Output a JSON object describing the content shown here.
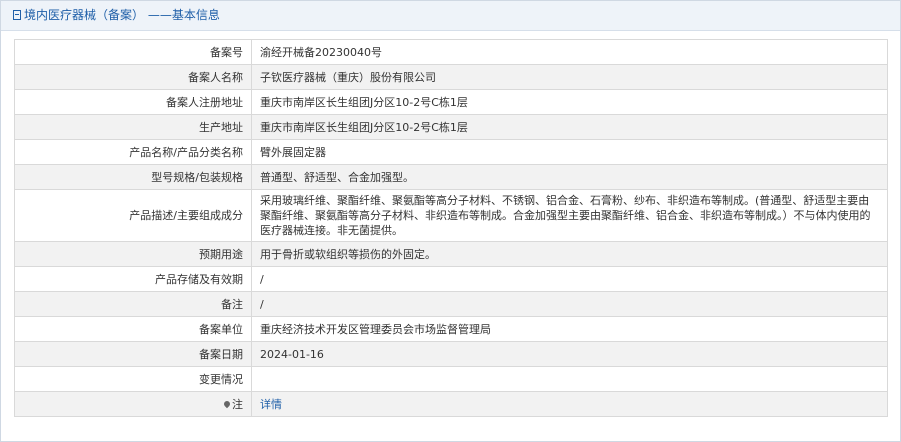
{
  "header": {
    "title": "境内医疗器械（备案）",
    "separator": "——",
    "subtitle": "基本信息"
  },
  "rows": [
    {
      "label": "备案号",
      "value": "渝经开械备20230040号"
    },
    {
      "label": "备案人名称",
      "value": "子钦医疗器械（重庆）股份有限公司"
    },
    {
      "label": "备案人注册地址",
      "value": "重庆市南岸区长生组团J分区10-2号C栋1层"
    },
    {
      "label": "生产地址",
      "value": "重庆市南岸区长生组团J分区10-2号C栋1层"
    },
    {
      "label": "产品名称/产品分类名称",
      "value": "臂外展固定器"
    },
    {
      "label": "型号规格/包装规格",
      "value": "普通型、舒适型、合金加强型。"
    },
    {
      "label": "产品描述/主要组成成分",
      "value": "采用玻璃纤维、聚酯纤维、聚氨酯等高分子材料、不锈钢、铝合金、石膏粉、纱布、非织造布等制成。(普通型、舒适型主要由聚酯纤维、聚氨酯等高分子材料、非织造布等制成。合金加强型主要由聚酯纤维、铝合金、非织造布等制成。）不与体内使用的医疗器械连接。非无菌提供。"
    },
    {
      "label": "预期用途",
      "value": "用于骨折或软组织等损伤的外固定。"
    },
    {
      "label": "产品存储及有效期",
      "value": "/"
    },
    {
      "label": "备注",
      "value": "/"
    },
    {
      "label": "备案单位",
      "value": "重庆经济技术开发区管理委员会市场监督管理局"
    },
    {
      "label": "备案日期",
      "value": "2024-01-16"
    },
    {
      "label": "变更情况",
      "value": ""
    }
  ],
  "note": {
    "label": "注",
    "link": "详情",
    "icon": "pin-icon"
  },
  "colors": {
    "accent": "#1f5fa8",
    "stripe": "#f2f2f2",
    "header_bg": "#eef3f9"
  }
}
